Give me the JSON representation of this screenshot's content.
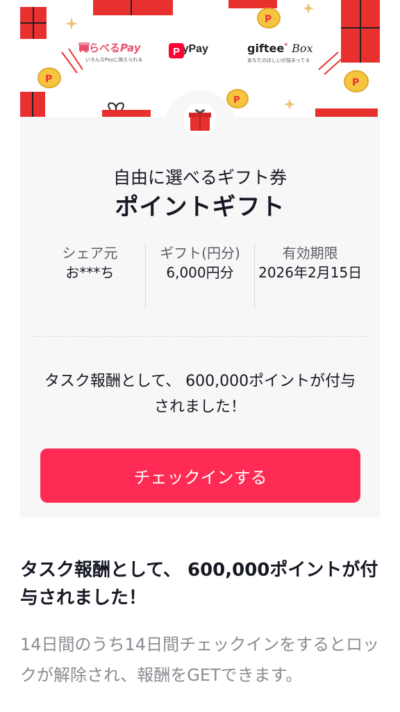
{
  "banner": {
    "erabell": {
      "brand": "えらべる",
      "brand_accent": "Pay",
      "tagline": "いろんなPayに換えられる"
    },
    "paypay": {
      "brand": "PayPay"
    },
    "giftee": {
      "brand": "giftee",
      "brand_accent": "Box",
      "tagline": "あなたのほしいが詰まってる"
    }
  },
  "gift": {
    "subtitle": "自由に選べるギフト券",
    "title": "ポイントギフト"
  },
  "info": {
    "sharer_label": "シェア元",
    "sharer_value": "お***ち",
    "amount_label": "ギフト(円分)",
    "amount_value": "6,000円分",
    "expiry_label": "有効期限",
    "expiry_value": "2026年2月15日"
  },
  "reward_message": "タスク報酬として、 600,000ポイントが付与されました！",
  "checkin_button": "チェックインする",
  "section": {
    "title": "タスク報酬として、 600,000ポイントが付与されました！",
    "description": "14日間のうち14日間チェックインをするとロックが解除され、報酬をGETできます。"
  },
  "colors": {
    "accent": "#fe2c55",
    "gift_red": "#e8302f",
    "coin_gold": "#f5c542",
    "card_bg": "#f7f7f7"
  }
}
